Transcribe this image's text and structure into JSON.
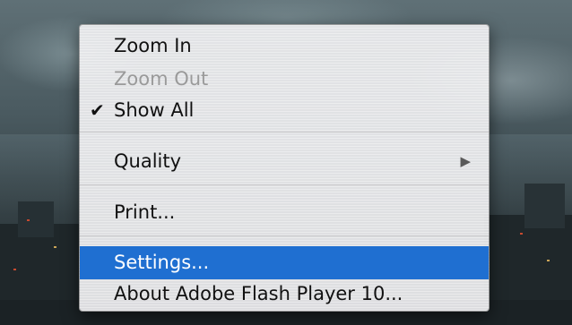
{
  "context_menu": {
    "items": [
      {
        "label": "Zoom In"
      },
      {
        "label": "Zoom Out"
      },
      {
        "label": "Show All",
        "checkmark": "✔"
      },
      {
        "label": "Quality",
        "submenu_arrow": "▶"
      },
      {
        "label": "Print..."
      },
      {
        "label": "Settings..."
      },
      {
        "label": "About Adobe Flash Player 10..."
      }
    ]
  },
  "colors": {
    "highlight": "#1f6fd1",
    "disabled_text": "#9a9a9a"
  }
}
